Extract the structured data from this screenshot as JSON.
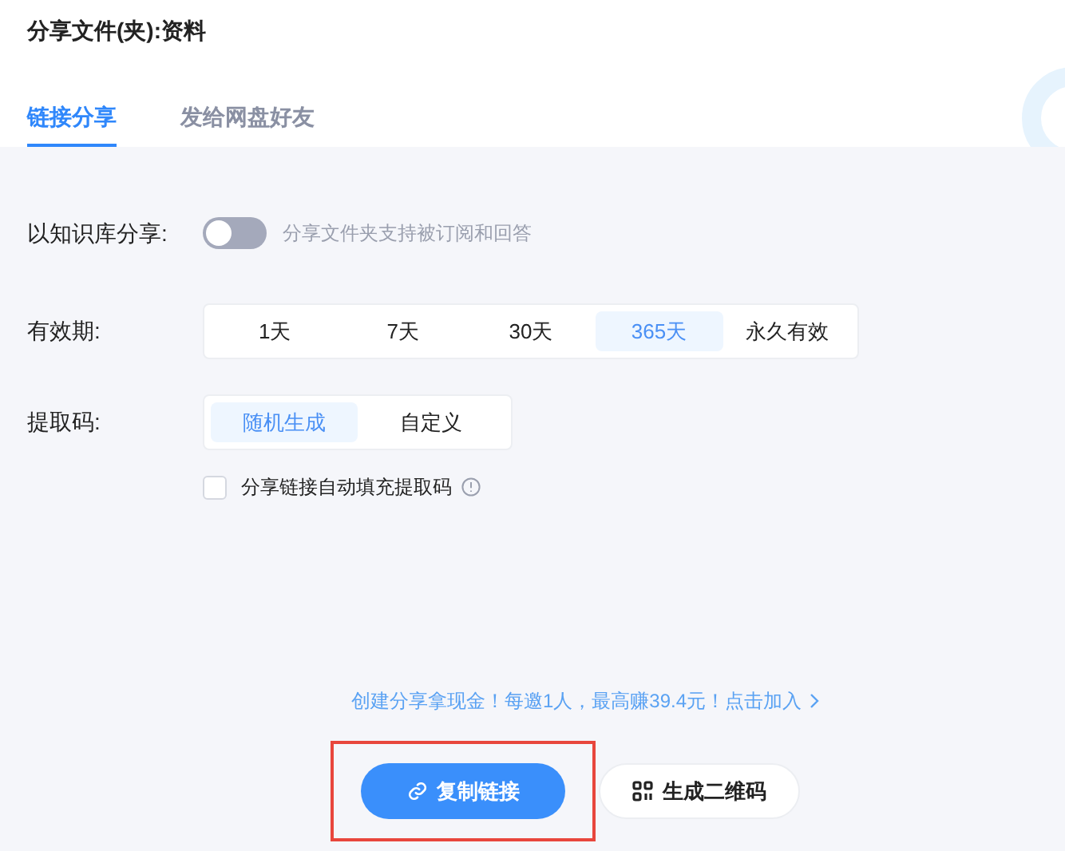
{
  "title": "分享文件(夹):资料",
  "tabs": [
    {
      "label": "链接分享",
      "selected": true
    },
    {
      "label": "发给网盘好友",
      "selected": false
    }
  ],
  "knowledge_share": {
    "label": "以知识库分享:",
    "on": false,
    "hint": "分享文件夹支持被订阅和回答"
  },
  "validity": {
    "label": "有效期:",
    "options": [
      {
        "label": "1天",
        "selected": false
      },
      {
        "label": "7天",
        "selected": false
      },
      {
        "label": "30天",
        "selected": false
      },
      {
        "label": "365天",
        "selected": true
      },
      {
        "label": "永久有效",
        "selected": false
      }
    ]
  },
  "code": {
    "label": "提取码:",
    "options": [
      {
        "label": "随机生成",
        "selected": true
      },
      {
        "label": "自定义",
        "selected": false
      }
    ]
  },
  "autofill": {
    "label": "分享链接自动填充提取码",
    "checked": false
  },
  "promo": "创建分享拿现金！每邀1人，最高赚39.4元！点击加入",
  "buttons": [
    {
      "kind": "primary",
      "label": "复制链接",
      "highlighted": true
    },
    {
      "kind": "qr",
      "label": "生成二维码",
      "highlighted": false
    }
  ]
}
